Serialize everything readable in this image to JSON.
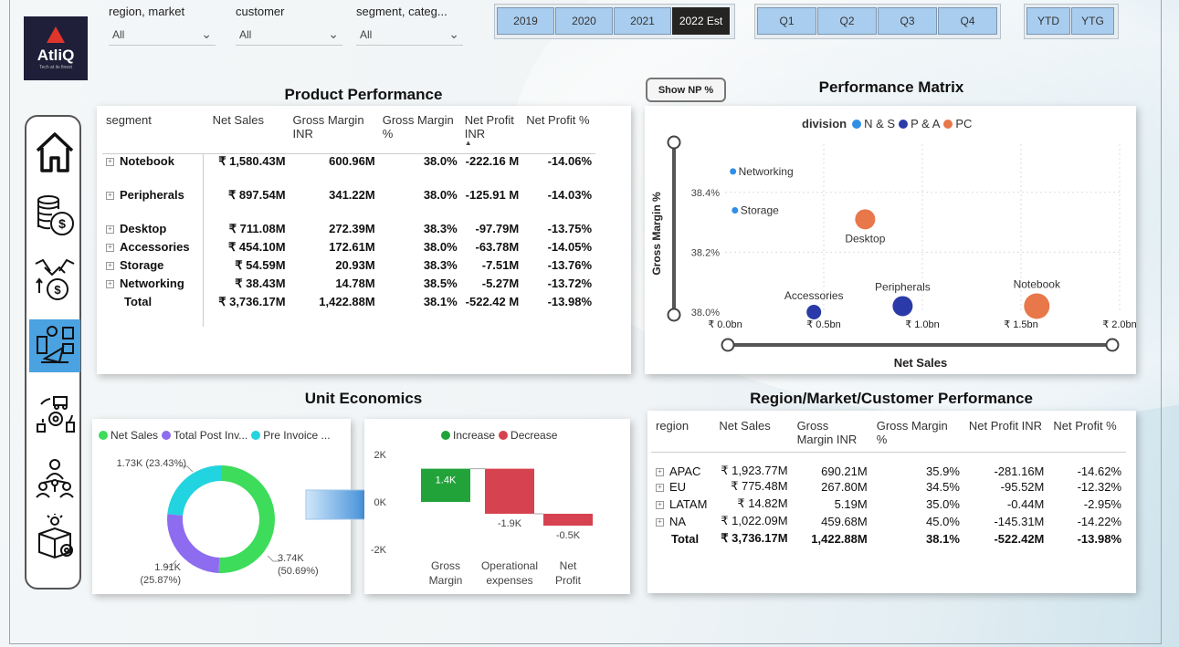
{
  "logo": {
    "name": "AtliQ",
    "tagline": "Tech at its finest"
  },
  "slicers": [
    {
      "label": "region, market",
      "value": "All"
    },
    {
      "label": "customer",
      "value": "All"
    },
    {
      "label": "segment, categ...",
      "value": "All"
    }
  ],
  "year_buttons": [
    {
      "label": "2019",
      "selected": false
    },
    {
      "label": "2020",
      "selected": false
    },
    {
      "label": "2021",
      "selected": false
    },
    {
      "label": "2022 Est",
      "selected": true
    }
  ],
  "quarter_buttons": [
    "Q1",
    "Q2",
    "Q3",
    "Q4"
  ],
  "period_buttons": [
    "YTD",
    "YTG"
  ],
  "nav_icons": [
    "home-icon",
    "finance-coins-icon",
    "sales-handshake-icon",
    "marketing-icon",
    "supply-chain-icon",
    "executive-team-icon",
    "settings-box-icon"
  ],
  "product_performance": {
    "title": "Product Performance",
    "columns": [
      "segment",
      "Net Sales",
      "Gross Margin INR",
      "Gross Margin %",
      "Net Profit INR",
      "Net Profit %"
    ],
    "rows": [
      {
        "segment": "Notebook",
        "net_sales": "₹ 1,580.43M",
        "gm_inr": "600.96M",
        "gm_pct": "38.0%",
        "np_inr": "-222.16 M",
        "np_pct": "-14.06%"
      },
      {
        "segment": "Peripherals",
        "net_sales": "₹ 897.54M",
        "gm_inr": "341.22M",
        "gm_pct": "38.0%",
        "np_inr": "-125.91 M",
        "np_pct": "-14.03%"
      },
      {
        "segment": "Desktop",
        "net_sales": "₹ 711.08M",
        "gm_inr": "272.39M",
        "gm_pct": "38.3%",
        "np_inr": "-97.79M",
        "np_pct": "-13.75%"
      },
      {
        "segment": "Accessories",
        "net_sales": "₹ 454.10M",
        "gm_inr": "172.61M",
        "gm_pct": "38.0%",
        "np_inr": "-63.78M",
        "np_pct": "-14.05%"
      },
      {
        "segment": "Storage",
        "net_sales": "₹ 54.59M",
        "gm_inr": "20.93M",
        "gm_pct": "38.3%",
        "np_inr": "-7.51M",
        "np_pct": "-13.76%"
      },
      {
        "segment": "Networking",
        "net_sales": "₹ 38.43M",
        "gm_inr": "14.78M",
        "gm_pct": "38.5%",
        "np_inr": "-5.27M",
        "np_pct": "-13.72%"
      }
    ],
    "total": {
      "segment": "Total",
      "net_sales": "₹ 3,736.17M",
      "gm_inr": "1,422.88M",
      "gm_pct": "38.1%",
      "np_inr": "-522.42 M",
      "np_pct": "-13.98%"
    }
  },
  "show_np_button": "Show NP %",
  "unit_economics": {
    "title": "Unit Economics"
  },
  "region_performance": {
    "title": "Region/Market/Customer Performance",
    "columns": [
      "region",
      "Net Sales",
      "Gross Margin INR",
      "Gross Margin %",
      "Net Profit INR",
      "Net Profit %"
    ],
    "rows": [
      {
        "region": "APAC",
        "net_sales": "₹ 1,923.77M",
        "gm_inr": "690.21M",
        "gm_pct": "35.9%",
        "np_inr": "-281.16M",
        "np_pct": "-14.62%"
      },
      {
        "region": "EU",
        "net_sales": "₹ 775.48M",
        "gm_inr": "267.80M",
        "gm_pct": "34.5%",
        "np_inr": "-95.52M",
        "np_pct": "-12.32%"
      },
      {
        "region": "LATAM",
        "net_sales": "₹ 14.82M",
        "gm_inr": "5.19M",
        "gm_pct": "35.0%",
        "np_inr": "-0.44M",
        "np_pct": "-2.95%"
      },
      {
        "region": "NA",
        "net_sales": "₹ 1,022.09M",
        "gm_inr": "459.68M",
        "gm_pct": "45.0%",
        "np_inr": "-145.31M",
        "np_pct": "-14.22%"
      }
    ],
    "total": {
      "region": "Total",
      "net_sales": "₹ 3,736.17M",
      "gm_inr": "1,422.88M",
      "gm_pct": "38.1%",
      "np_inr": "-522.42M",
      "np_pct": "-13.98%"
    }
  },
  "chart_data": [
    {
      "type": "scatter",
      "title": "Performance Matrix",
      "xlabel": "Net Sales",
      "ylabel": "Gross Margin %",
      "legend_title": "division",
      "legend_position": "top",
      "legend": [
        {
          "name": "N & S",
          "color": "#2f8ee6"
        },
        {
          "name": "P & A",
          "color": "#2a3aa8"
        },
        {
          "name": "PC",
          "color": "#e8774a"
        }
      ],
      "xlim": [
        0,
        2.0
      ],
      "ylim": [
        38.0,
        38.5
      ],
      "x_ticks": [
        "₹ 0.0bn",
        "₹ 0.5bn",
        "₹ 1.0bn",
        "₹ 1.5bn",
        "₹ 2.0bn"
      ],
      "y_ticks": [
        "38.0%",
        "38.2%",
        "38.4%"
      ],
      "points": [
        {
          "label": "Networking",
          "x": 0.04,
          "y": 38.47,
          "division": "N & S",
          "size": 0.04
        },
        {
          "label": "Storage",
          "x": 0.05,
          "y": 38.34,
          "division": "N & S",
          "size": 0.05
        },
        {
          "label": "Desktop",
          "x": 0.71,
          "y": 38.31,
          "division": "PC",
          "size": 0.71
        },
        {
          "label": "Accessories",
          "x": 0.45,
          "y": 38.0,
          "division": "P & A",
          "size": 0.45
        },
        {
          "label": "Peripherals",
          "x": 0.9,
          "y": 38.02,
          "division": "P & A",
          "size": 0.9
        },
        {
          "label": "Notebook",
          "x": 1.58,
          "y": 38.02,
          "division": "PC",
          "size": 1.58
        }
      ],
      "grid": true
    },
    {
      "type": "pie",
      "donut": true,
      "legend": [
        {
          "name": "Net Sales",
          "color": "#3ddc5a"
        },
        {
          "name": "Total Post Inv...",
          "color": "#8d6cf0"
        },
        {
          "name": "Pre Invoice ...",
          "color": "#22d3e0"
        }
      ],
      "slices": [
        {
          "name": "Net Sales",
          "value": 3.74,
          "label": "3.74K (50.69%)",
          "color": "#3ddc5a"
        },
        {
          "name": "Total Post Inv...",
          "value": 1.91,
          "label": "1.91K (25.87%)",
          "color": "#8d6cf0"
        },
        {
          "name": "Pre Invoice ...",
          "value": 1.73,
          "label": "1.73K (23.43%)",
          "color": "#22d3e0"
        }
      ]
    },
    {
      "type": "bar",
      "subtype": "waterfall",
      "legend": [
        {
          "name": "Increase",
          "color": "#22a33a"
        },
        {
          "name": "Decrease",
          "color": "#d6424f"
        }
      ],
      "categories": [
        "Gross Margin",
        "Operational expenses",
        "Net Profit"
      ],
      "values": [
        1.4,
        -1.9,
        -0.5
      ],
      "value_labels": [
        "1.4K",
        "-1.9K",
        "-0.5K"
      ],
      "y_ticks": [
        "2K",
        "0K",
        "-2K"
      ],
      "ylim": [
        -2,
        2
      ]
    }
  ]
}
